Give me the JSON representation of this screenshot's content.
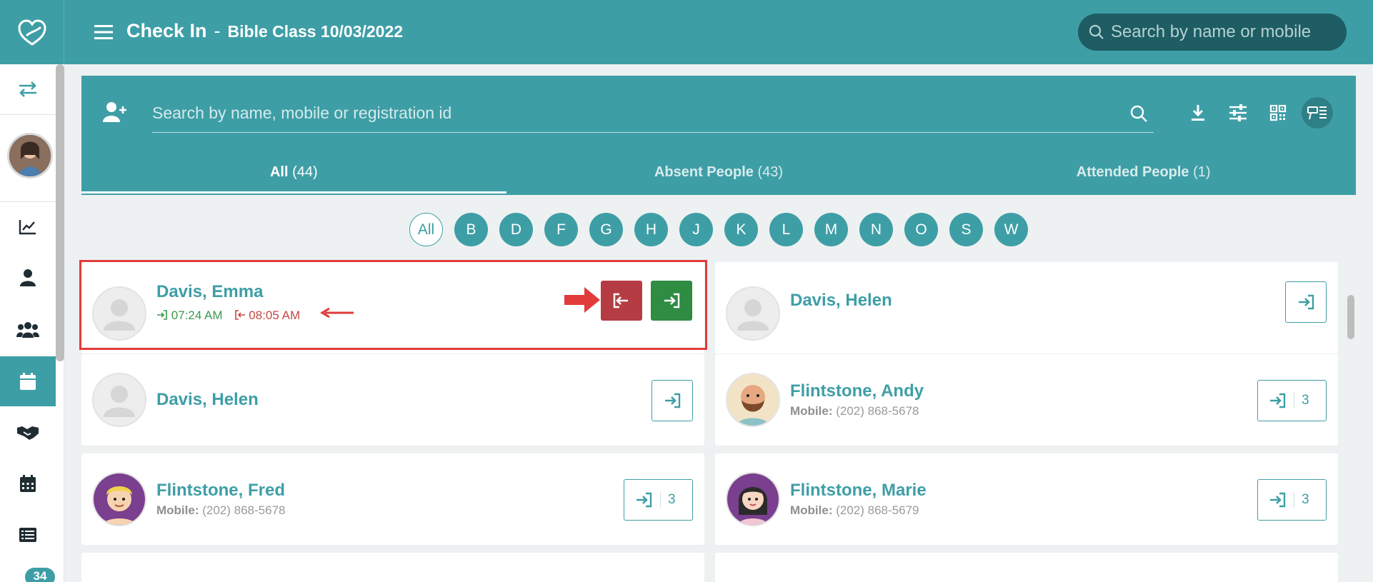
{
  "header": {
    "title": "Check In",
    "separator": "-",
    "subtitle": "Bible Class 10/03/2022",
    "search_placeholder": "Search by name or mobile"
  },
  "sidebar": {
    "items": [
      {
        "icon": "swap-icon"
      },
      {
        "icon": "profile-avatar"
      },
      {
        "icon": "chart-icon"
      },
      {
        "icon": "person-icon"
      },
      {
        "icon": "group-icon"
      },
      {
        "icon": "calendar-icon",
        "active": true
      },
      {
        "icon": "handshake-icon"
      },
      {
        "icon": "calendar-grid-icon"
      },
      {
        "icon": "list-icon"
      }
    ],
    "badge": "34"
  },
  "panel": {
    "search_placeholder": "Search by name, mobile or registration id",
    "tools": [
      "download-icon",
      "filter-sliders-icon",
      "qr-code-icon",
      "display-settings-icon"
    ],
    "tabs": [
      {
        "label": "All",
        "count": "(44)",
        "active": true
      },
      {
        "label": "Absent People",
        "count": "(43)",
        "active": false
      },
      {
        "label": "Attended People",
        "count": "(1)",
        "active": false
      }
    ]
  },
  "letters": {
    "selected": "All",
    "items": [
      "All",
      "B",
      "D",
      "F",
      "G",
      "H",
      "J",
      "K",
      "L",
      "M",
      "N",
      "O",
      "S",
      "W"
    ]
  },
  "cards": [
    {
      "name": "Davis, Emma",
      "checkin_time": "07:24 AM",
      "checkout_time": "08:05 AM"
    },
    {
      "name": "Davis, Helen"
    },
    {
      "name": "Davis, Helen"
    },
    {
      "name": "Flintstone, Andy",
      "mobile_label": "Mobile:",
      "mobile": "(202) 868-5678",
      "count": "3"
    },
    {
      "name": "Flintstone, Fred",
      "mobile_label": "Mobile:",
      "mobile": "(202) 868-5678",
      "count": "3"
    },
    {
      "name": "Flintstone, Marie",
      "mobile_label": "Mobile:",
      "mobile": "(202) 868-5679",
      "count": "3"
    }
  ],
  "colors": {
    "primary": "#3e9ea6",
    "checkout": "#b63c43",
    "checkin": "#2e8c43",
    "annotation": "#e23b3b"
  }
}
